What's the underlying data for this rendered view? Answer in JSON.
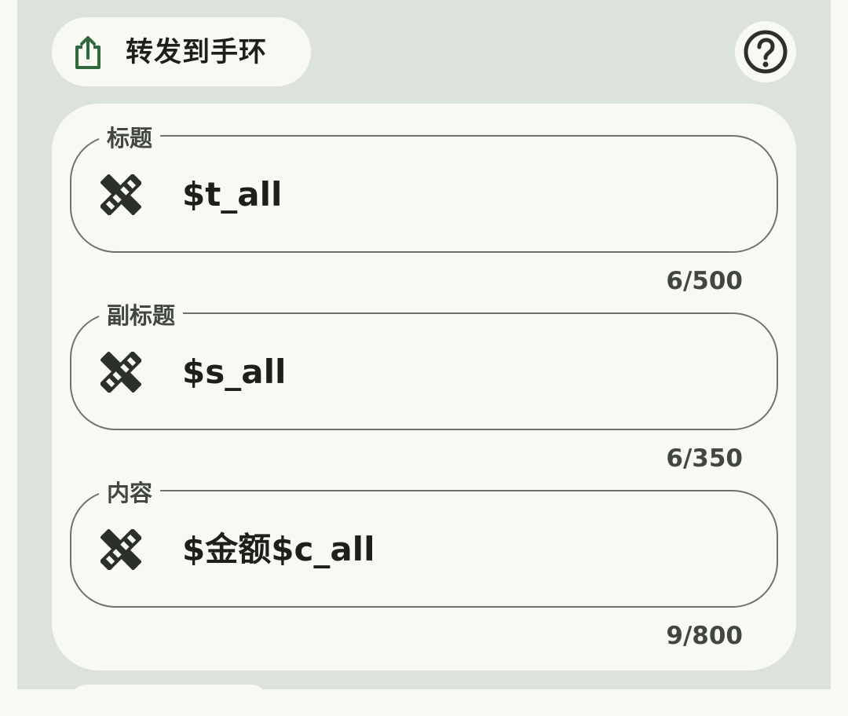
{
  "header": {
    "forward_label": "转发到手环",
    "forward_icon": "share-icon",
    "help_icon": "help-icon"
  },
  "fields": [
    {
      "legend": "标题",
      "value": "$t_all",
      "counter": "6/500",
      "icon": "edit-ruler-icon"
    },
    {
      "legend": "副标题",
      "value": "$s_all",
      "counter": "6/350",
      "icon": "edit-ruler-icon"
    },
    {
      "legend": "内容",
      "value": "$金额$c_all",
      "counter": "9/800",
      "icon": "edit-ruler-icon"
    }
  ],
  "colors": {
    "panel": "#dce3da",
    "surface": "#f8f9f3",
    "accent": "#2f6a3a",
    "outline": "#6e736d"
  }
}
